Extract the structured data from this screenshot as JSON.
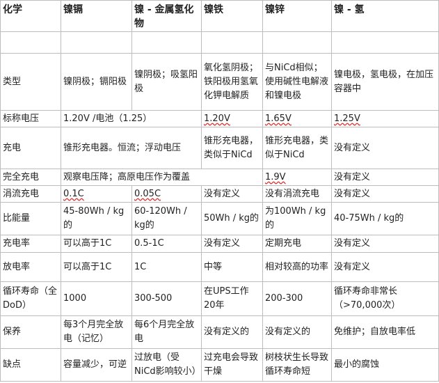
{
  "headers": [
    "化学",
    "镍镉",
    "镍 - 金属氢化物",
    "镍铁",
    "镍锌",
    "镍 - 氢"
  ],
  "rows": [
    {
      "label": "类型",
      "cells": [
        "镍阴极；镉阳极",
        "镍阴极；吸氢阳极",
        "氧化氢阴极；铁阳极用氢氧化钾电解质",
        "与NiCd相似；使用碱性电解液和镍电极",
        "镍电极，氢电极，在加压容器中"
      ]
    },
    {
      "label": "标称电压",
      "cells": [
        "1.20V /电池（1.25）",
        "",
        "1.20V",
        "1.65V",
        "1.25V"
      ]
    },
    {
      "label": "充电",
      "cells": [
        "锥形充电器。恒流；浮动电压",
        "",
        "锥形充电器，类似于NiCd",
        "锥形充电器，类似于NiCd",
        "没有定义"
      ]
    },
    {
      "label": "完全充电",
      "cells": [
        "观察电压降；高原电压作为覆盖",
        "",
        "",
        "1.9V",
        "没有定义"
      ]
    },
    {
      "label": "涓流充电",
      "cells": [
        "0.1C",
        "0.05C",
        "没有定义",
        "没有涓流充电",
        "没有定义"
      ]
    },
    {
      "label": "比能量",
      "cells": [
        "45-80Wh / kg的",
        "60-120Wh / kg的",
        "50Wh / kg的",
        "为100Wh / kg的",
        "40-75Wh / kg的"
      ]
    },
    {
      "label": "充电率",
      "cells": [
        "可以高于1C",
        "0.5-1C",
        "没有定义",
        "定期充电",
        "没有定义"
      ]
    },
    {
      "label": "放电率",
      "cells": [
        "可以高于1C",
        "1C",
        "中等",
        "相对较高的功率",
        "没有定义"
      ]
    },
    {
      "label": "循环寿命（全DoD）",
      "cells": [
        "1000",
        "300-500",
        "在UPS工作20年",
        "200-300",
        "循环寿命非常长（>70,000次）"
      ]
    },
    {
      "label": "保养",
      "cells": [
        "每3个月完全放电（记忆）",
        "每6个月完全放电",
        "没有定义的",
        "没有定义的",
        "免维护；自放电率低"
      ]
    },
    {
      "label": "缺点",
      "cells": [
        "容量减少，可逆",
        "过放电（受NiCd影响较小）",
        "过充电会导致干燥",
        "树枝状生长导致循环寿命短",
        "最小的腐蚀"
      ]
    }
  ]
}
